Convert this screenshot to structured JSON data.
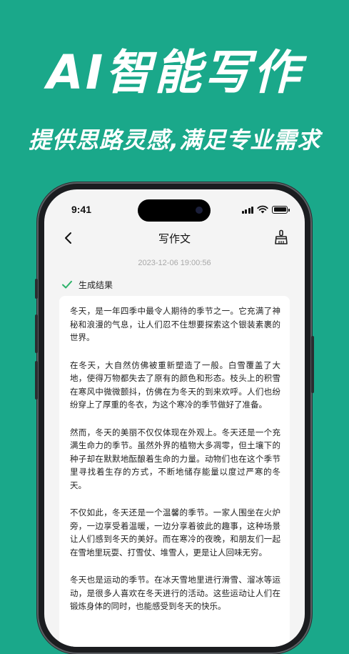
{
  "hero": {
    "title": "AI智能写作",
    "subtitle": "提供思路灵感,满足专业需求"
  },
  "status_bar": {
    "time": "9:41",
    "icons": [
      "signal-icon",
      "wifi-icon",
      "battery-icon"
    ]
  },
  "nav": {
    "back_icon": "chevron-left-icon",
    "title": "写作文",
    "action_icon": "broom-clean-icon"
  },
  "timestamp": "2023-12-06 19:00:56",
  "result": {
    "label": "生成结果",
    "status_icon": "check-icon"
  },
  "article": {
    "paragraphs": [
      "冬天，是一年四季中最令人期待的季节之一。它充满了神秘和浪漫的气息，让人们忍不住想要探索这个银装素裹的世界。",
      "在冬天，大自然仿佛被重新塑造了一般。白雪覆盖了大地，使得万物都失去了原有的颜色和形态。枝头上的积雪在寒风中微微颤抖，仿佛在为冬天的到来欢呼。人们也纷纷穿上了厚重的冬衣，为这个寒冷的季节做好了准备。",
      "然而，冬天的美丽不仅仅体现在外观上。冬天还是一个充满生命力的季节。虽然外界的植物大多凋零，但土壤下的种子却在默默地酝酿着生命的力量。动物们也在这个季节里寻找着生存的方式，不断地储存能量以度过严寒的冬天。",
      "不仅如此，冬天还是一个温馨的季节。一家人围坐在火炉旁，一边享受着温暖，一边分享着彼此的趣事，这种场景让人们感到冬天的美好。而在寒冷的夜晚，和朋友们一起在雪地里玩耍、打雪仗、堆雪人，更是让人回味无穷。",
      "冬天也是运动的季节。在冰天雪地里进行滑雪、溜冰等运动，是很多人喜欢在冬天进行的活动。这些运动让人们在锻炼身体的同时，也能感受到冬天的快乐。"
    ]
  },
  "colors": {
    "background": "#1aa88a",
    "accent_check": "#2fb36b",
    "card": "#ffffff",
    "screen": "#f4f4f4"
  }
}
